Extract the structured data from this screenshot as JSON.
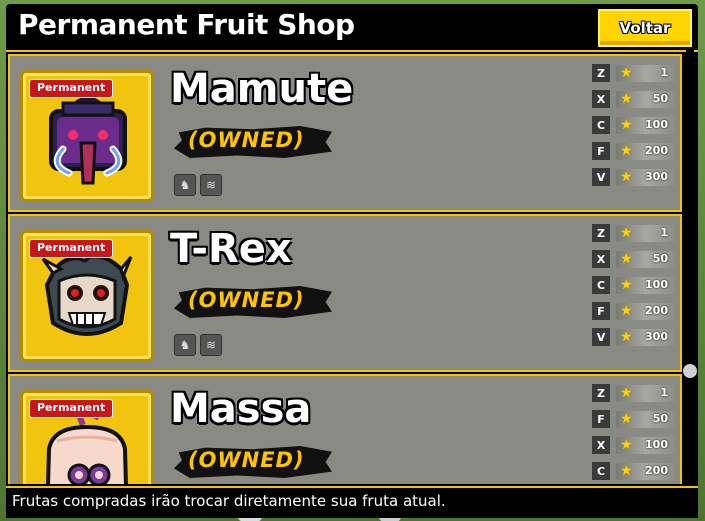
{
  "shop": {
    "title": "Permanent Fruit Shop",
    "back_label": "Voltar",
    "footer_note": "Frutas compradas irão trocar diretamente sua fruta atual."
  },
  "fruits": [
    {
      "tag": "Permanent",
      "name": "Mamute",
      "status": "(OWNED)",
      "icon": "mammoth-fruit-icon",
      "moves": [
        {
          "key": "Z",
          "level": "1"
        },
        {
          "key": "X",
          "level": "50"
        },
        {
          "key": "C",
          "level": "100"
        },
        {
          "key": "F",
          "level": "200"
        },
        {
          "key": "V",
          "level": "300"
        }
      ]
    },
    {
      "tag": "Permanent",
      "name": "T-Rex",
      "status": "(OWNED)",
      "icon": "trex-fruit-icon",
      "moves": [
        {
          "key": "Z",
          "level": "1"
        },
        {
          "key": "X",
          "level": "50"
        },
        {
          "key": "C",
          "level": "100"
        },
        {
          "key": "F",
          "level": "200"
        },
        {
          "key": "V",
          "level": "300"
        }
      ]
    },
    {
      "tag": "Permanent",
      "name": "Massa",
      "status": "(OWNED)",
      "icon": "dough-fruit-icon",
      "moves": [
        {
          "key": "Z",
          "level": "1"
        },
        {
          "key": "F",
          "level": "50"
        },
        {
          "key": "X",
          "level": "100"
        },
        {
          "key": "C",
          "level": "200"
        }
      ]
    }
  ]
}
